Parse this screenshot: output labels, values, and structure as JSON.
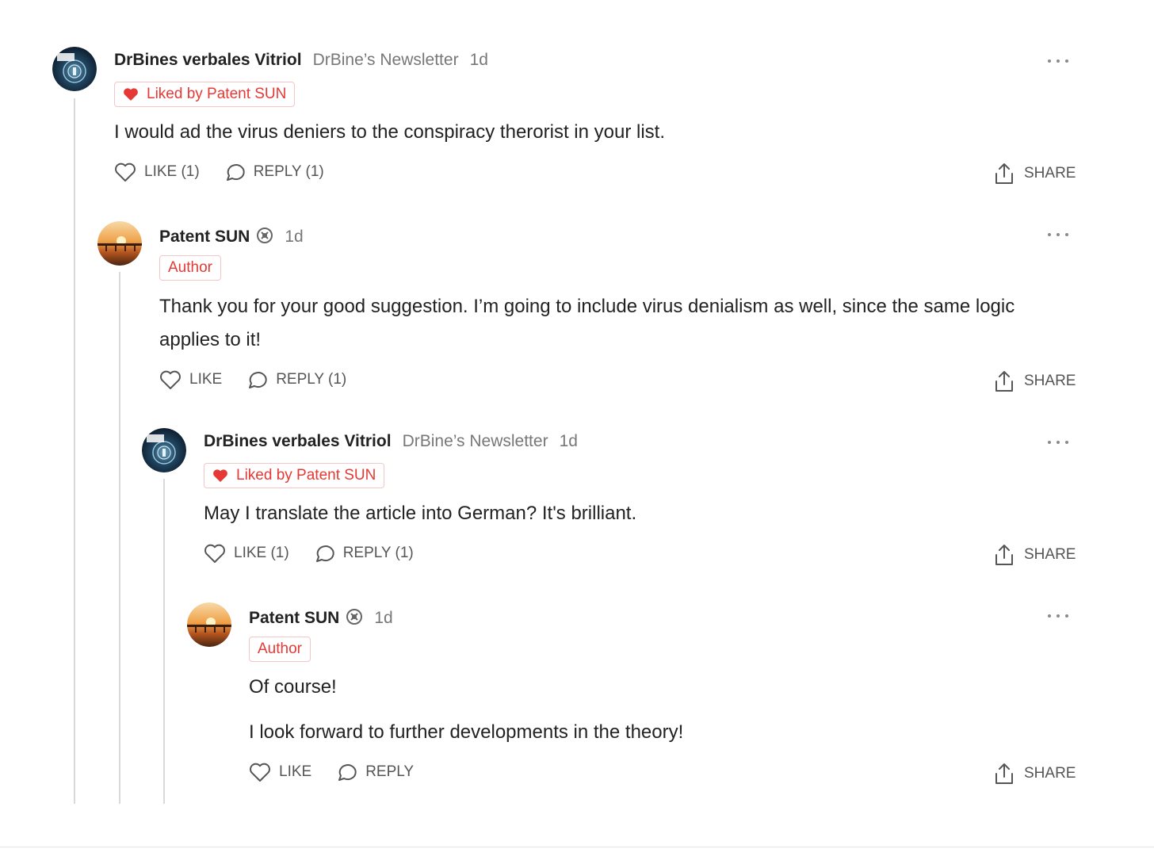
{
  "comments": [
    {
      "author": "DrBines verbales Vitriol",
      "publication": "DrBine’s Newsletter",
      "time": "1d",
      "avatar_icon": "newsletter-logo-avatar",
      "chip": "Liked by Patent SUN",
      "body": [
        "I would ad the virus deniers to the conspiracy therorist in your list."
      ],
      "like": "LIKE (1)",
      "reply": "REPLY (1)",
      "share": "SHARE"
    },
    {
      "author": "Patent SUN",
      "time": "1d",
      "avatar_icon": "sunset-pier-avatar",
      "author_badge_icon": "subscriber-badge-icon",
      "chip": "Author",
      "body": [
        "Thank you for your good suggestion. I’m going to include virus denialism as well, since the same logic applies to it!"
      ],
      "like": "LIKE",
      "reply": "REPLY (1)",
      "share": "SHARE"
    },
    {
      "author": "DrBines verbales Vitriol",
      "publication": "DrBine’s Newsletter",
      "time": "1d",
      "avatar_icon": "newsletter-logo-avatar",
      "chip": "Liked by Patent SUN",
      "body": [
        "May I translate the article into German? It's brilliant."
      ],
      "like": "LIKE (1)",
      "reply": "REPLY (1)",
      "share": "SHARE"
    },
    {
      "author": "Patent SUN",
      "time": "1d",
      "avatar_icon": "sunset-pier-avatar",
      "author_badge_icon": "subscriber-badge-icon",
      "chip": "Author",
      "body": [
        "Of course!",
        "I look forward to further developments in the theory!"
      ],
      "like": "LIKE",
      "reply": "REPLY",
      "share": "SHARE"
    }
  ],
  "colors": {
    "accent_red": "#e53935",
    "muted_text": "#777777",
    "thread_line": "#d9d9d9"
  }
}
